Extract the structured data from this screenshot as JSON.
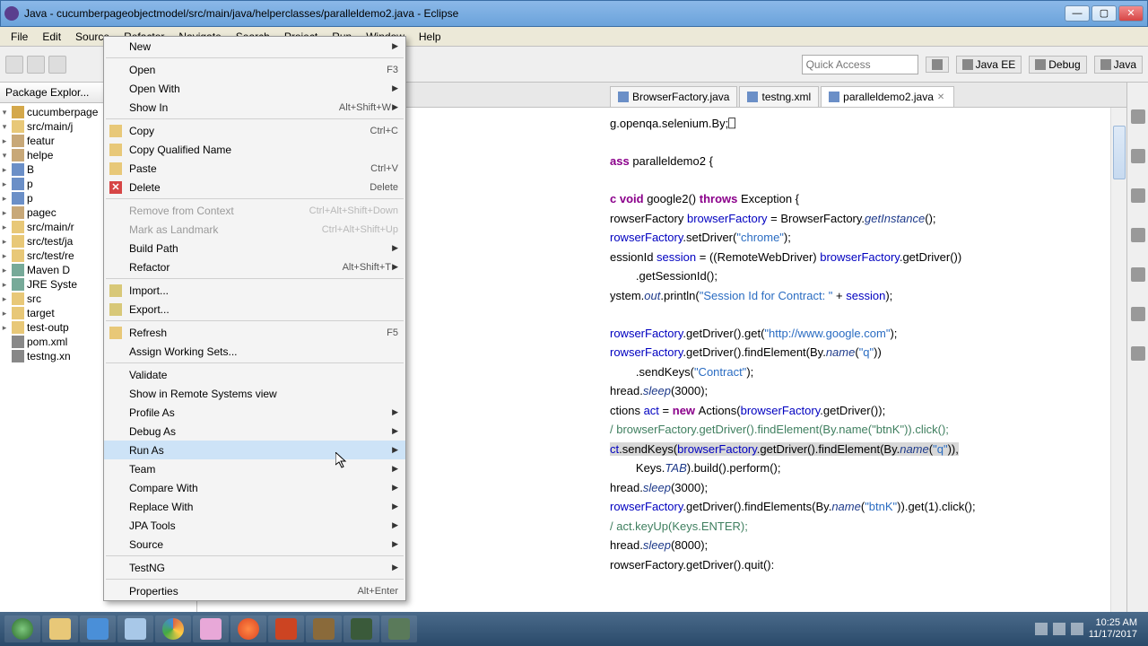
{
  "window": {
    "title": "Java - cucumberpageobjectmodel/src/main/java/helperclasses/paralleldemo2.java - Eclipse"
  },
  "menubar": [
    "File",
    "Edit",
    "Source",
    "Refactor",
    "Navigate",
    "Search",
    "Project",
    "Run",
    "Window",
    "Help"
  ],
  "quick_access": "Quick Access",
  "perspectives": {
    "javaee": "Java EE",
    "debug": "Debug",
    "java": "Java"
  },
  "pkg_title": "Package Explor...",
  "tree": {
    "proj": "cucumberpage",
    "src_main": "src/main/j",
    "featur": "featur",
    "helpe": "helpe",
    "B": "B",
    "p_a": "p",
    "p_b": "p",
    "pagec": "pagec",
    "src_main2": "src/main/r",
    "src_test": "src/test/ja",
    "src_test_r": "src/test/re",
    "maven": "Maven D",
    "jre": "JRE Syste",
    "src": "src",
    "target": "target",
    "test_out": "test-outp",
    "pom": "pom.xml",
    "testng": "testng.xn"
  },
  "tabs": {
    "t1": "BrowserFactory.java",
    "t2": "testng.xml",
    "t3": "paralleldemo2.java"
  },
  "code": {
    "l1a": "g.openqa.selenium.By;",
    "l2a": "ass ",
    "l2b": "paralleldemo2 {",
    "l3a": "c void ",
    "l3b": "google2() ",
    "l3c": "throws ",
    "l3d": "Exception {",
    "l4a": "rowserFactory ",
    "l4b": "browserFactory",
    "l4c": " = BrowserFactory.",
    "l4d": "getInstance",
    "l4e": "();",
    "l5a": "rowserFactory",
    "l5b": ".setDriver(",
    "l5c": "\"chrome\"",
    "l5d": ");",
    "l6a": "essionId ",
    "l6b": "session",
    "l6c": " = ((RemoteWebDriver) ",
    "l6d": "browserFactory",
    "l6e": ".getDriver())",
    "l7a": "        .getSessionId();",
    "l8a": "ystem.",
    "l8b": "out",
    "l8c": ".println(",
    "l8d": "\"Session Id for Contract: \"",
    "l8e": " + ",
    "l8f": "session",
    "l8g": ");",
    "l9a": "rowserFactory",
    "l9b": ".getDriver().get(",
    "l9c": "\"http://www.google.com\"",
    "l9d": ");",
    "l10a": "rowserFactory",
    "l10b": ".getDriver().findElement(By.",
    "l10c": "name",
    "l10d": "(",
    "l10e": "\"q\"",
    "l10f": "))",
    "l11a": "        .sendKeys(",
    "l11b": "\"Contract\"",
    "l11c": ");",
    "l12a": "hread.",
    "l12b": "sleep",
    "l12c": "(3000);",
    "l13a": "ctions ",
    "l13b": "act",
    "l13c": " = ",
    "l13d": "new ",
    "l13e": "Actions(",
    "l13f": "browserFactory",
    "l13g": ".getDriver());",
    "l14a": "/ browserFactory.getDriver().findElement(By.name(\"btnK\")).click();",
    "l15a": "ct",
    "l15b": ".sendKeys(",
    "l15c": "browserFactory",
    "l15d": ".getDriver().findElement(By.",
    "l15e": "name",
    "l15f": "(",
    "l15g": "\"q\"",
    "l15h": ")),",
    "l16a": "        Keys.",
    "l16b": "TAB",
    "l16c": ").build().perform();",
    "l17a": "hread.",
    "l17b": "sleep",
    "l17c": "(3000);",
    "l18a": "rowserFactory",
    "l18b": ".getDriver().findElements(By.",
    "l18c": "name",
    "l18d": "(",
    "l18e": "\"btnK\"",
    "l18f": ")).get(1).click();",
    "l19a": "/ act.keyUp(Keys.ENTER);",
    "l20a": "hread.",
    "l20b": "sleep",
    "l20c": "(8000);",
    "l21a": "rowserFactory.getDriver().quit():"
  },
  "context_menu": {
    "new": "New",
    "open": "Open",
    "open_sc": "F3",
    "open_with": "Open With",
    "show_in": "Show In",
    "show_in_sc": "Alt+Shift+W",
    "copy": "Copy",
    "copy_sc": "Ctrl+C",
    "copy_qn": "Copy Qualified Name",
    "paste": "Paste",
    "paste_sc": "Ctrl+V",
    "delete": "Delete",
    "delete_sc": "Delete",
    "remove_ctx": "Remove from Context",
    "remove_ctx_sc": "Ctrl+Alt+Shift+Down",
    "mark_lm": "Mark as Landmark",
    "mark_lm_sc": "Ctrl+Alt+Shift+Up",
    "build_path": "Build Path",
    "refactor": "Refactor",
    "refactor_sc": "Alt+Shift+T",
    "import": "Import...",
    "export": "Export...",
    "refresh": "Refresh",
    "refresh_sc": "F5",
    "assign_ws": "Assign Working Sets...",
    "validate": "Validate",
    "show_rs": "Show in Remote Systems view",
    "profile_as": "Profile As",
    "debug_as": "Debug As",
    "run_as": "Run As",
    "team": "Team",
    "compare_with": "Compare With",
    "replace_with": "Replace With",
    "jpa_tools": "JPA Tools",
    "source": "Source",
    "testng": "TestNG",
    "properties": "Properties",
    "properties_sc": "Alt+Enter"
  },
  "tray": {
    "time": "10:25 AM",
    "date": "11/17/2017"
  }
}
